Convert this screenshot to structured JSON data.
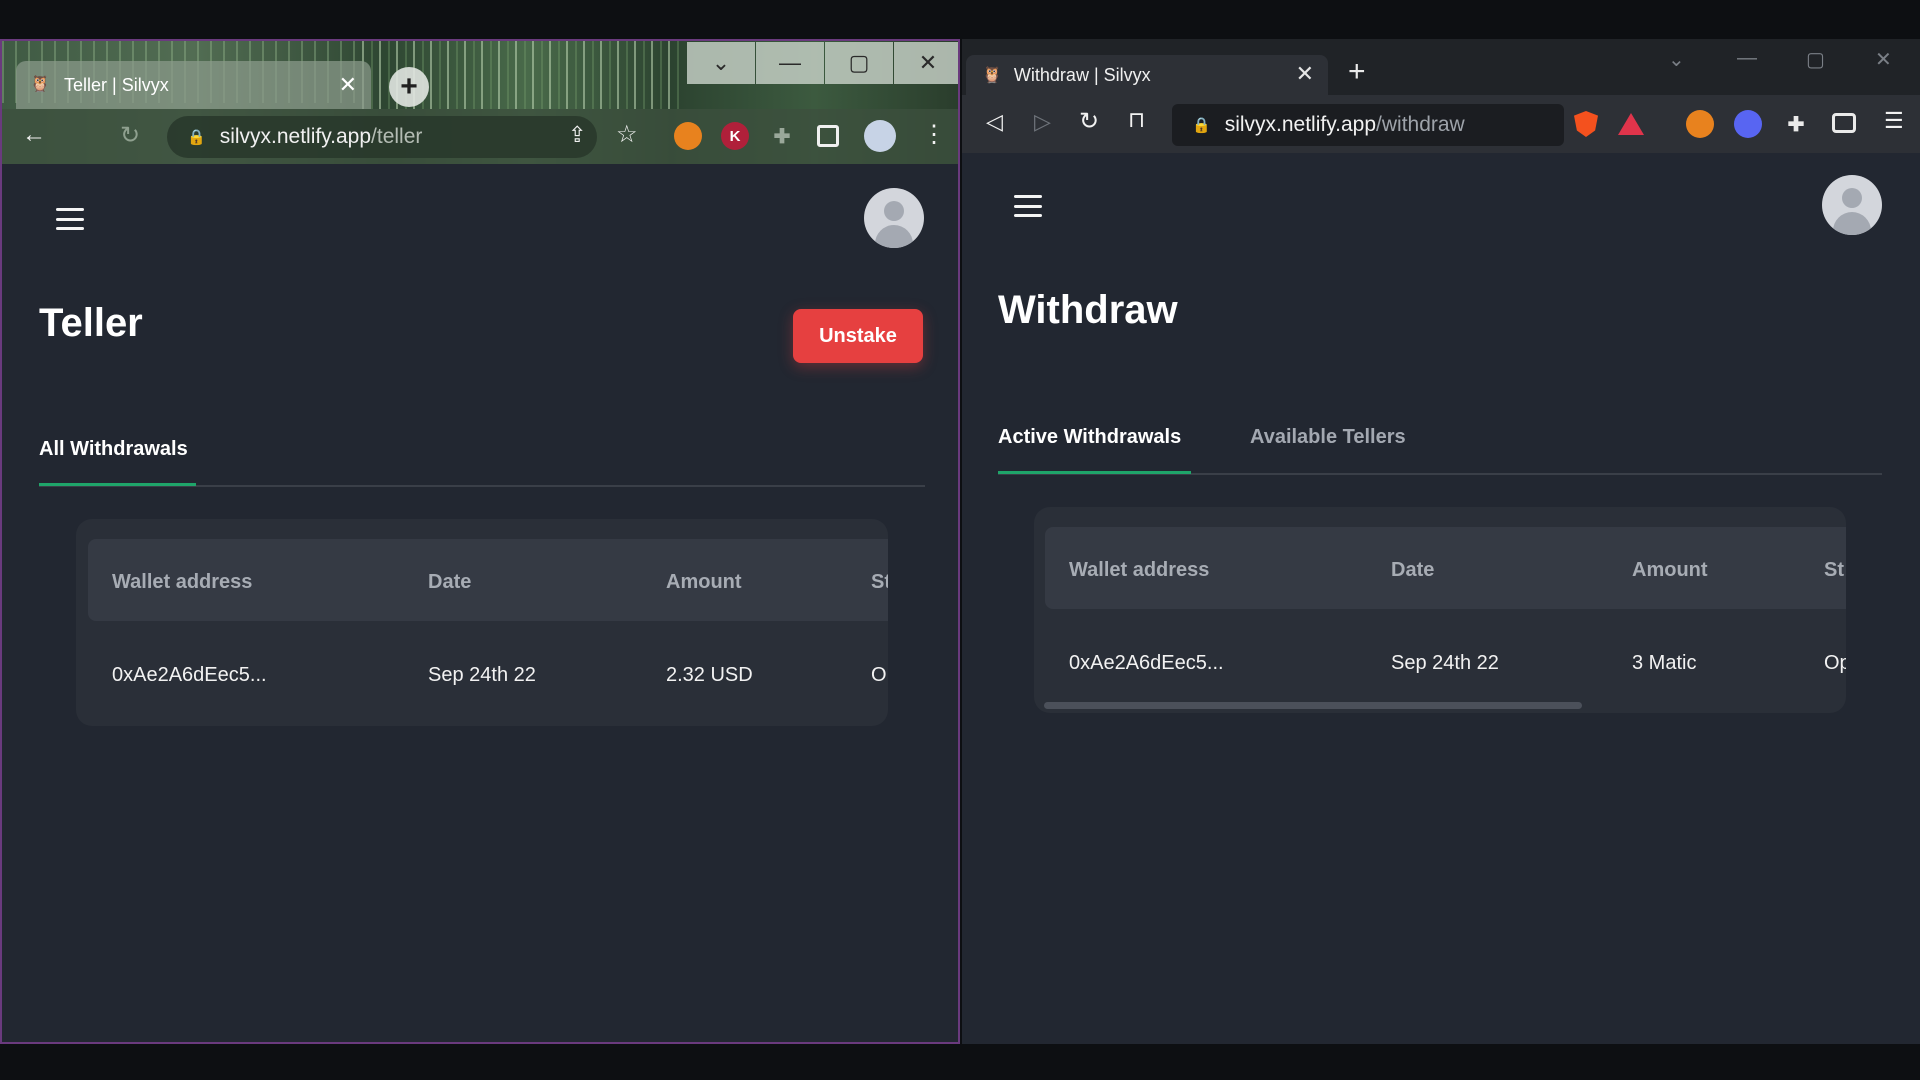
{
  "left_window": {
    "tab_title": "Teller | Silvyx",
    "url_host": "silvyx.netlify.app",
    "url_path": "/teller",
    "page_title": "Teller",
    "unstake_label": "Unstake",
    "tabs": [
      {
        "label": "All Withdrawals",
        "active": true
      }
    ],
    "table": {
      "headers": [
        "Wallet address",
        "Date",
        "Amount",
        "St"
      ],
      "rows": [
        [
          "0xAe2A6dEec5...",
          "Sep 24th 22",
          "2.32 USD",
          "O"
        ]
      ]
    },
    "extensions": [
      "metamask-icon",
      "k-extension-icon",
      "puzzle-icon",
      "side-panel-icon",
      "profile-avatar"
    ]
  },
  "right_window": {
    "tab_title": "Withdraw | Silvyx",
    "url_host": "silvyx.netlify.app",
    "url_path": "/withdraw",
    "page_title": "Withdraw",
    "tabs": [
      {
        "label": "Active Withdrawals",
        "active": true
      },
      {
        "label": "Available Tellers",
        "active": false
      }
    ],
    "table": {
      "headers": [
        "Wallet address",
        "Date",
        "Amount",
        "St"
      ],
      "rows": [
        [
          "0xAe2A6dEec5...",
          "Sep 24th 22",
          "3 Matic",
          "Op"
        ]
      ]
    },
    "extensions": [
      "brave-shield-icon",
      "bat-rewards-icon",
      "metamask-icon",
      "discord-like-icon",
      "puzzle-icon",
      "wallet-icon",
      "menu-icon"
    ]
  },
  "colors": {
    "page_bg": "#222731",
    "card_bg": "#2a2f38",
    "header_row_bg": "#353a44",
    "accent_green": "#1fa56a",
    "danger_red": "#e64040"
  },
  "icons": {
    "close": "✕",
    "plus": "+",
    "minimize": "—",
    "maximize": "▢",
    "chevron_down": "⌄",
    "lock": "🔒",
    "back": "←",
    "reload": "↻",
    "share": "⇪",
    "star": "☆",
    "kebab": "⋮",
    "triangle_left": "◁",
    "triangle_right": "▷",
    "bookmark": "⊓",
    "hamburger_menu": "☰",
    "favicon": "🦉"
  }
}
